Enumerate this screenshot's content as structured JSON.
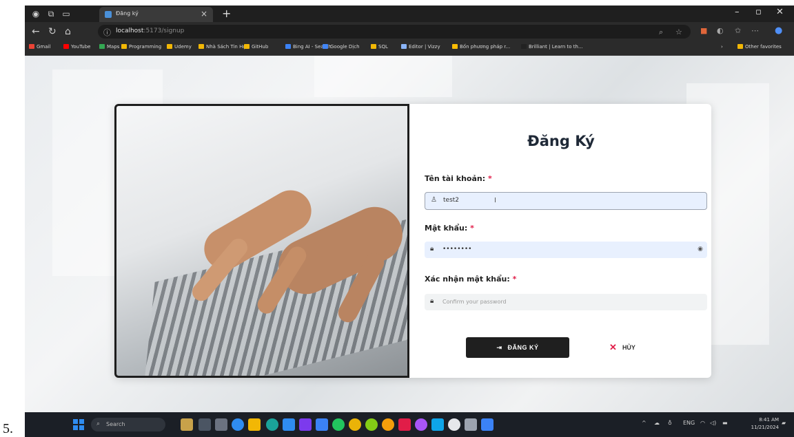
{
  "outer_label": "5.",
  "browser": {
    "tab_title": "Đăng ký",
    "tab_close": "×",
    "new_tab": "+",
    "url_host": "localhost",
    "url_rest": ":5173/signup",
    "bookmarks": [
      {
        "label": "Gmail",
        "color": "#ea4335"
      },
      {
        "label": "YouTube",
        "color": "#ff0000"
      },
      {
        "label": "Maps",
        "color": "#34a853"
      },
      {
        "label": "Programming",
        "color": "#f2b705"
      },
      {
        "label": "Udemy",
        "color": "#f2b705"
      },
      {
        "label": "Nhà Sách Tin Học",
        "color": "#f2b705"
      },
      {
        "label": "GitHub",
        "color": "#f2b705"
      },
      {
        "label": "Bing AI - Search",
        "color": "#3b82f6"
      },
      {
        "label": "Google Dịch",
        "color": "#4285f4"
      },
      {
        "label": "SQL",
        "color": "#f2b705"
      },
      {
        "label": "Editor | Vizzy",
        "color": "#8ab4f8"
      },
      {
        "label": "Bốn phương pháp r...",
        "color": "#fbbc04"
      },
      {
        "label": "Brilliant | Learn to th...",
        "color": "#222222"
      }
    ],
    "other_favorites": "Other favorites"
  },
  "form": {
    "title": "Đăng Ký",
    "username_label": "Tên tài khoản:",
    "username_value": "test2",
    "password_label": "Mật khẩu:",
    "password_value": "••••••••",
    "confirm_label": "Xác nhận mật khẩu:",
    "confirm_placeholder": "Confirm your password",
    "required_mark": "*",
    "submit_label": "ĐĂNG KÝ",
    "cancel_label": "HỦY"
  },
  "taskbar": {
    "search_label": "Search",
    "lang": "ENG",
    "time": "8:41 AM",
    "date": "11/21/2024"
  }
}
